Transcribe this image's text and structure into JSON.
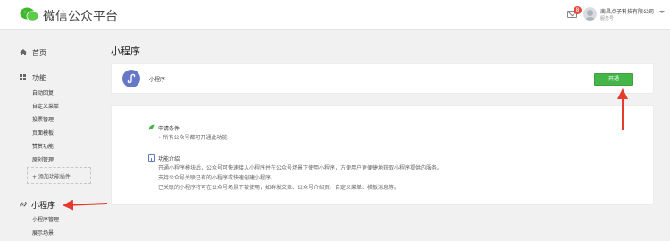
{
  "header": {
    "app_title": "微信公众平台",
    "notification_count": "8",
    "account_name": "南昌点子科技有限公司",
    "account_type": "服务号"
  },
  "sidebar": {
    "home": "首页",
    "functions": "功能",
    "function_items": [
      "自动回复",
      "自定义菜单",
      "投票管理",
      "页面模板",
      "赞赏功能",
      "原创管理"
    ],
    "add_plugin": "+ 添加功能插件",
    "mini_program": "小程序",
    "mini_items": [
      "小程序管理",
      "展示场景"
    ]
  },
  "main": {
    "title": "小程序",
    "app_name": "小程序",
    "open_button": "开通",
    "conditions": {
      "heading": "申请条件",
      "items": [
        "• 所有公众号都可开通此功能"
      ]
    },
    "intro": {
      "heading": "功能介绍",
      "lines": [
        "开通小程序模块后，公众号可快速接入小程序并在公众号场景下使用小程序，方便用户更便捷地获取小程序提供的服务。",
        "支持公众号关联已有的小程序或快速创建小程序。",
        "已关联的小程序将可在公众号场景下被使用，如群发文章、公众号介绍页、自定义菜单、模板消息等。"
      ]
    }
  },
  "colors": {
    "accent_green": "#44b549",
    "annotation_red": "#e53b2c",
    "logo_purple": "#6677c7"
  }
}
